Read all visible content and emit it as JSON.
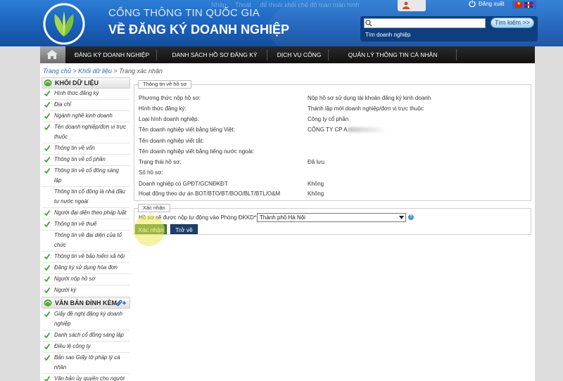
{
  "header": {
    "title_line1": "CỔNG THÔNG TIN QUỐC GIA",
    "title_line2": "VỀ ĐĂNG KÝ DOANH NGHIỆP",
    "top_links": [
      "Nhập",
      "Thoát",
      "để thoát khỏi chế độ toàn màn hình"
    ],
    "logout_label": "Đăng xuất",
    "search": {
      "placeholder": "",
      "button_label": "Tìm kiếm >>",
      "link_label": "Tìm doanh nghiệp"
    }
  },
  "nav": {
    "items": [
      "ĐĂNG KÝ DOANH NGHIỆP",
      "DANH SÁCH HỒ SƠ ĐĂNG KÝ",
      "DỊCH VỤ CÔNG",
      "QUẢN LÝ THÔNG TIN CÁ NHÂN"
    ]
  },
  "breadcrumb": {
    "home": "Trang chủ",
    "sep": " > ",
    "level1": "Khối dữ liệu",
    "current": "Trang xác nhận"
  },
  "sidebar": {
    "section1_title": "KHỐI DỮ LIỆU",
    "section1_items": [
      {
        "lines": [
          "Hình thức đăng ký"
        ],
        "checked": true
      },
      {
        "lines": [
          "Địa chỉ"
        ],
        "checked": true
      },
      {
        "lines": [
          "Ngành nghề kinh doanh"
        ],
        "checked": true
      },
      {
        "lines": [
          "Tên doanh nghiệp/đơn vị trực",
          "thuộc"
        ],
        "checked": true
      },
      {
        "lines": [
          "Thông tin về vốn"
        ],
        "checked": true
      },
      {
        "lines": [
          "Thông tin về cổ phần"
        ],
        "checked": true
      },
      {
        "lines": [
          "Thông tin về cổ đông sáng",
          "lập"
        ],
        "checked": true
      },
      {
        "lines": [
          "Thông tin cổ đông là nhà đầu",
          "tư nước ngoài"
        ],
        "checked": false
      },
      {
        "lines": [
          "Người đại diện theo pháp luật"
        ],
        "checked": true
      },
      {
        "lines": [
          "Thông tin về thuế"
        ],
        "checked": true
      },
      {
        "lines": [
          "Thông tin về đại diện của tổ",
          "chức"
        ],
        "checked": false
      },
      {
        "lines": [
          "Thông tin về bảo hiểm xã hội"
        ],
        "checked": true
      },
      {
        "lines": [
          "Đăng ký sử dụng hóa đơn"
        ],
        "checked": true
      },
      {
        "lines": [
          "Người nộp hồ sơ"
        ],
        "checked": true
      },
      {
        "lines": [
          "Người ký"
        ],
        "checked": true
      }
    ],
    "section2_title": "VĂN BẢN ĐÍNH KÈM",
    "section2_items": [
      {
        "lines": [
          "Giấy đề nghị đăng ký doanh",
          "nghiệp"
        ],
        "checked": true
      },
      {
        "lines": [
          "Danh sách cổ đông sáng lập"
        ],
        "checked": true
      },
      {
        "lines": [
          "Điều lệ công ty"
        ],
        "checked": true
      },
      {
        "lines": [
          "Bản sao Giấy tờ pháp lý cá",
          "nhân"
        ],
        "checked": true
      },
      {
        "lines": [
          "Văn bản ủy quyền cho người"
        ],
        "checked": true
      }
    ]
  },
  "info_panel": {
    "tab_label": "Thông tin về hồ sơ",
    "rows": [
      {
        "label": "Phương thức nộp hồ sơ:",
        "value": "Nộp hồ sơ sử dụng tài khoản đăng ký kinh doanh"
      },
      {
        "label": "Hình thức đăng ký:",
        "value": "Thành lập mới doanh nghiệp/đơn vị trực thuộc"
      },
      {
        "label": "Loại hình doanh nghiệp:",
        "value": "Công ty cổ phần"
      },
      {
        "label": "Tên doanh nghiệp viết bằng tiếng Việt:",
        "value": "CÔNG TY CP A"
      },
      {
        "label": "Tên doanh nghiệp viết tắt:",
        "value": ""
      },
      {
        "label": "Tên doanh nghiệp viết bằng tiếng nước ngoài:",
        "value": ""
      },
      {
        "label": "Trạng thái hồ sơ:",
        "value": "Đã lưu"
      },
      {
        "label": "Số hồ sơ:",
        "value": ""
      },
      {
        "label": "Doanh nghiệp có GPĐT/GCNĐKĐT",
        "value": "Không"
      },
      {
        "label": "Hoạt động theo dự án BOT/BTO/BT/BOO/BLT/BTL/O&M",
        "value": "Không"
      }
    ]
  },
  "confirm_panel": {
    "tab_label": "Xác nhận",
    "select_label": "Hồ sơ sẽ được nộp tự động vào Phòng ĐKKD*:",
    "select_value": "Thành phố Hà Nội",
    "help": "?",
    "confirm_button": "Xác nhận",
    "back_button": "Trở về"
  },
  "colors": {
    "header_blue": "#1a5fb8",
    "nav_dark": "#1a1a1a",
    "link_blue": "#2a66b8",
    "check_green": "#3fa535",
    "confirm_green": "#3f7f39",
    "back_navy": "#1e3f6a"
  }
}
